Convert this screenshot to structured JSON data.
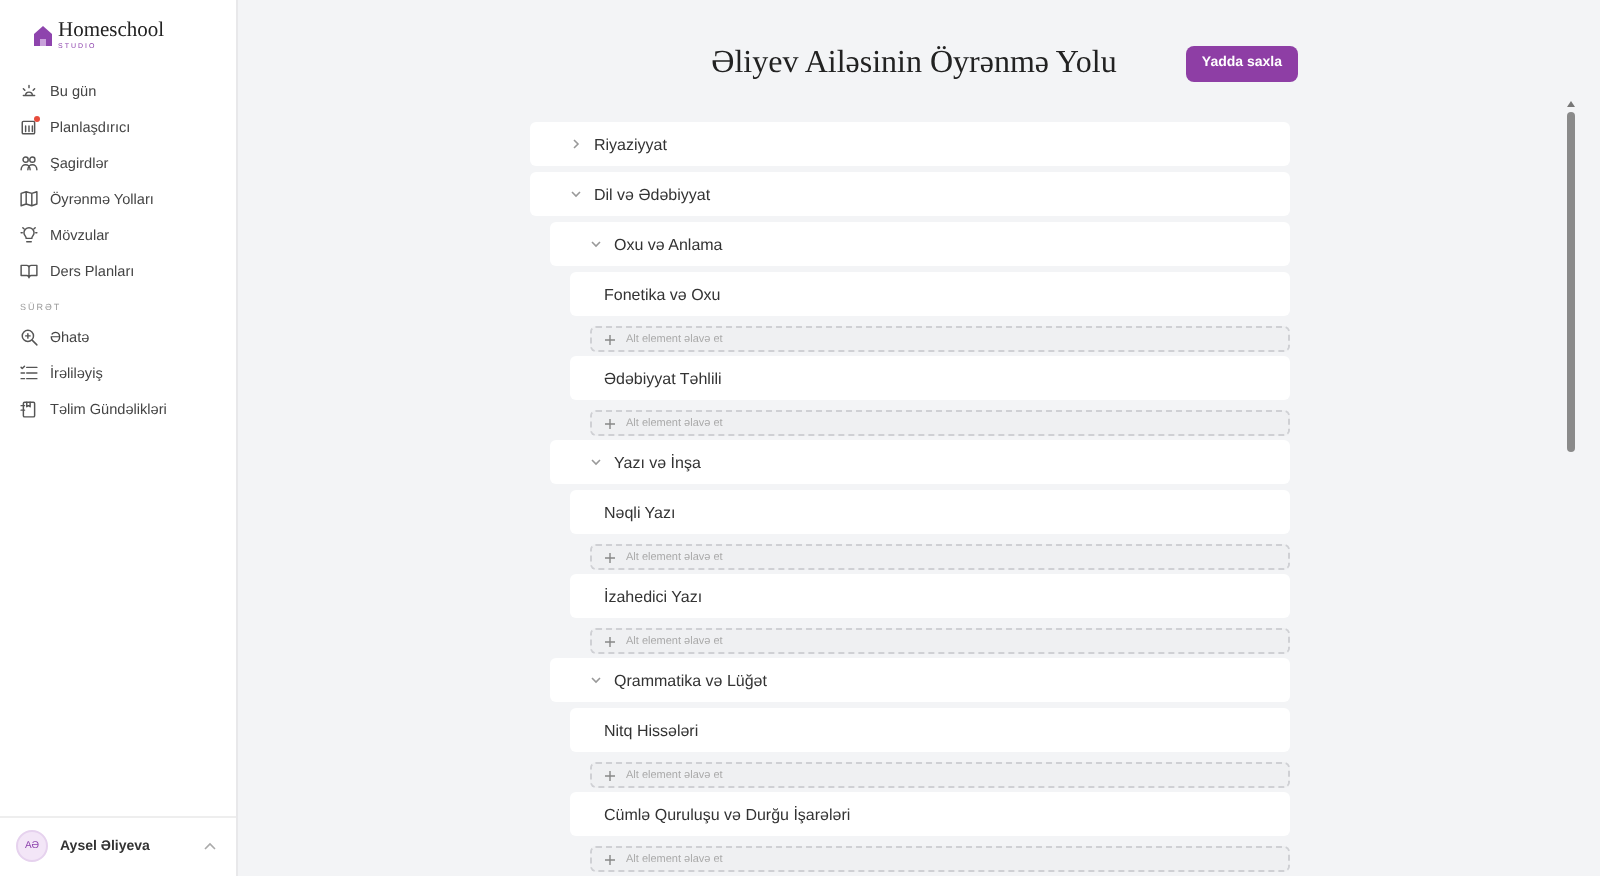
{
  "brand": {
    "name": "Homeschool",
    "tagline": "STUDIO"
  },
  "nav": [
    {
      "label": "Bu gün",
      "alert": false
    },
    {
      "label": "Planlaşdırıcı",
      "alert": true
    },
    {
      "label": "Şagirdlər",
      "alert": false
    },
    {
      "label": "Öyrənmə Yolları",
      "alert": false
    },
    {
      "label": "Mövzular",
      "alert": false
    },
    {
      "label": "Ders Planları",
      "alert": false
    }
  ],
  "nav_section": {
    "title": "SÜRƏT",
    "items": [
      {
        "label": "Əhatə",
        "alert": false
      },
      {
        "label": "İrəliləyiş",
        "alert": false
      },
      {
        "label": "Təlim Gündəlikləri",
        "alert": false
      }
    ]
  },
  "user": {
    "initials": "AƏ",
    "name": "Aysel Əliyeva"
  },
  "page": {
    "title": "Əliyev Ailəsinin Öyrənmə Yolu",
    "save_button": "Yadda saxla"
  },
  "tree": [
    {
      "label": "Riyaziyyat",
      "expanded": false
    },
    {
      "label": "Dil və Ədəbiyyat",
      "expanded": true,
      "children": [
        {
          "label": "Oxu və Anlama",
          "expanded": true,
          "children": [
            {
              "label": "Fonetika və Oxu",
              "add_label": "Alt element əlavə et"
            },
            {
              "label": "Ədəbiyyat Təhlili",
              "add_label": "Alt element əlavə et"
            }
          ]
        },
        {
          "label": "Yazı və İnşa",
          "expanded": true,
          "children": [
            {
              "label": "Nəqli Yazı",
              "add_label": "Alt element əlavə et"
            },
            {
              "label": "İzahedici Yazı",
              "add_label": "Alt element əlavə et"
            }
          ]
        },
        {
          "label": "Qrammatika və Lüğət",
          "expanded": true,
          "children": [
            {
              "label": "Nitq Hissələri",
              "add_label": "Alt element əlavə et"
            },
            {
              "label": "Cümlə Quruluşu və Durğu İşarələri",
              "add_label": "Alt element əlavə et"
            }
          ]
        }
      ]
    }
  ]
}
